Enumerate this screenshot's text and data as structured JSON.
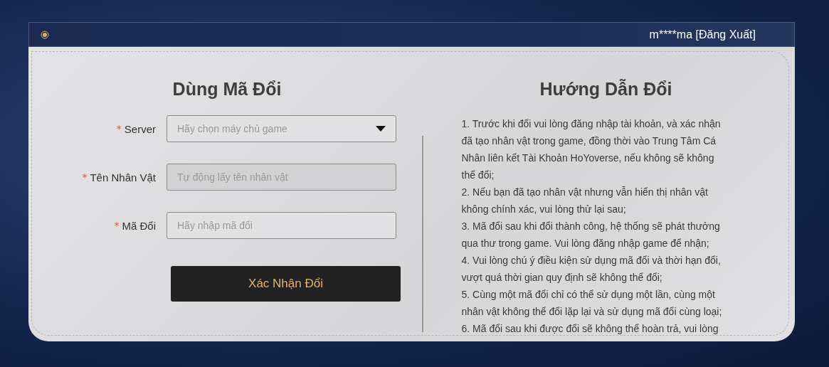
{
  "top_bar": {
    "user": "m****ma",
    "logout": "[Đăng Xuất]"
  },
  "redeem_form": {
    "title": "Dùng Mã Đổi",
    "fields": [
      {
        "kind": "select",
        "required_mark": "*",
        "label": "Server",
        "placeholder": "Hãy chọn máy chủ game",
        "disabled": false
      },
      {
        "kind": "input",
        "required_mark": "*",
        "label": "Tên Nhân Vật",
        "placeholder": "Tự động lấy tên nhân vật",
        "disabled": true
      },
      {
        "kind": "input",
        "required_mark": "*",
        "label": "Mã Đổi",
        "placeholder": "Hãy nhập mã đổi",
        "disabled": false
      }
    ],
    "submit_button": "Xác Nhận Đổi"
  },
  "guide": {
    "title": "Hướng Dẫn Đổi",
    "items": [
      "1. Trước khi đổi vui lòng đăng nhập tài khoản, và xác nhận đã tạo nhân vật trong game, đồng thời vào Trung Tâm Cá Nhân liên kết Tài Khoản HoYoverse, nếu không sẽ không thể đổi;",
      "2. Nếu bạn đã tạo nhân vật nhưng vẫn hiển thị nhân vật không chính xác, vui lòng thử lại sau;",
      "3. Mã đổi sau khi đổi thành công, hệ thống sẽ phát thưởng qua thư trong game. Vui lòng đăng nhập game để nhận;",
      "4. Vui lòng chú ý điều kiện sử dụng mã đổi và thời hạn đổi, vượt quá thời gian quy định sẽ không thể đổi;",
      "5. Cùng một mã đổi chỉ có thể sử dụng một lần, cùng một nhân vật không thể đổi lặp lại và sử dụng mã đổi cùng loại;",
      "6. Mã đổi sau khi được đổi sẽ không thể hoàn trả, vui lòng"
    ]
  }
}
